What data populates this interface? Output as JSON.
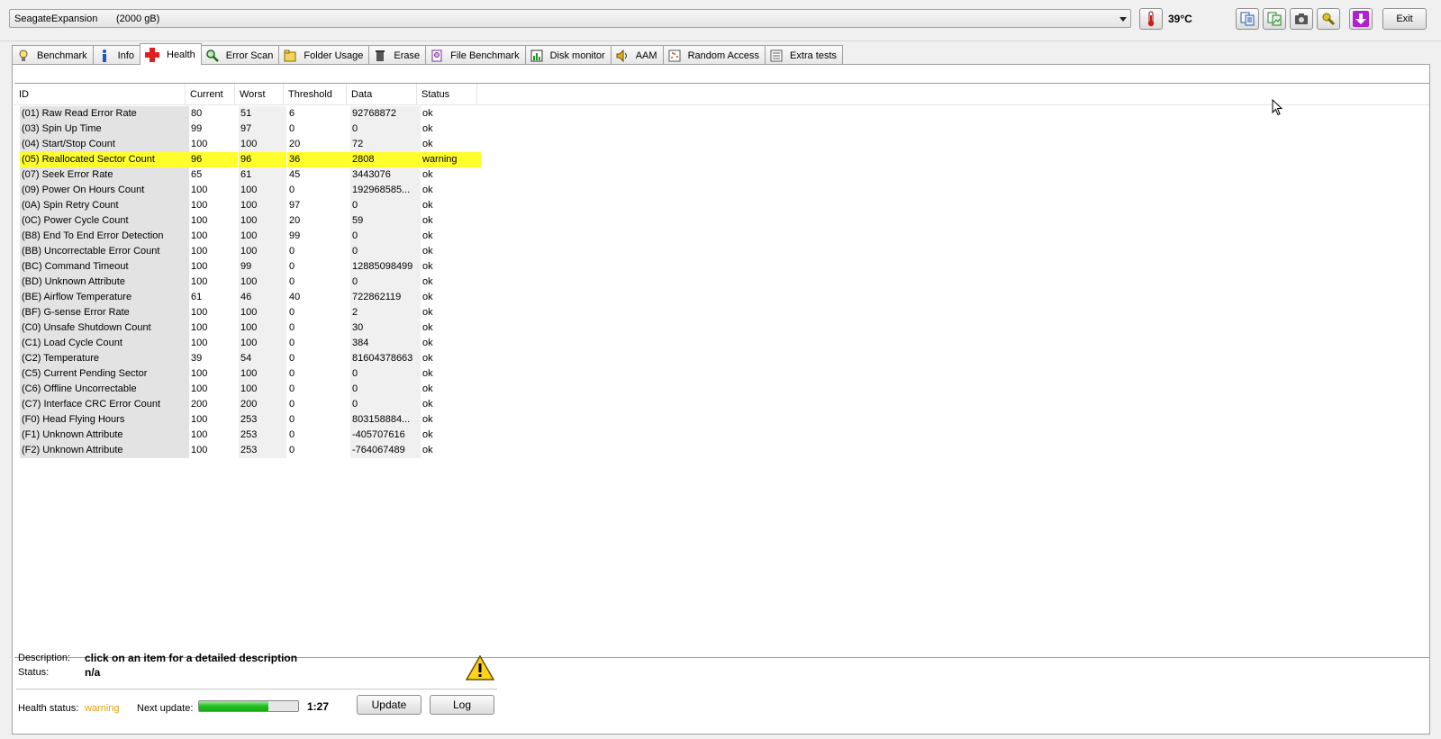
{
  "drive": {
    "name": "SeagateExpansion",
    "capacity": "(2000 gB)"
  },
  "temperature": "39°C",
  "toolbar": {
    "exit_label": "Exit"
  },
  "tabs": [
    {
      "label": "Benchmark",
      "icon": "bulb-icon"
    },
    {
      "label": "Info",
      "icon": "info-icon"
    },
    {
      "label": "Health",
      "icon": "health-cross-icon",
      "active": true
    },
    {
      "label": "Error Scan",
      "icon": "magnifier-icon"
    },
    {
      "label": "Folder Usage",
      "icon": "folder-icon"
    },
    {
      "label": "Erase",
      "icon": "trash-icon"
    },
    {
      "label": "File Benchmark",
      "icon": "file-benchmark-icon"
    },
    {
      "label": "Disk monitor",
      "icon": "monitor-chart-icon"
    },
    {
      "label": "AAM",
      "icon": "speaker-icon"
    },
    {
      "label": "Random Access",
      "icon": "random-access-icon"
    },
    {
      "label": "Extra tests",
      "icon": "extra-tests-icon"
    }
  ],
  "table": {
    "headers": {
      "id": "ID",
      "current": "Current",
      "worst": "Worst",
      "threshold": "Threshold",
      "data": "Data",
      "status": "Status"
    },
    "rows": [
      {
        "id": "(01) Raw Read Error Rate",
        "current": "80",
        "worst": "51",
        "threshold": "6",
        "data": "92768872",
        "status": "ok"
      },
      {
        "id": "(03) Spin Up Time",
        "current": "99",
        "worst": "97",
        "threshold": "0",
        "data": "0",
        "status": "ok"
      },
      {
        "id": "(04) Start/Stop Count",
        "current": "100",
        "worst": "100",
        "threshold": "20",
        "data": "72",
        "status": "ok"
      },
      {
        "id": "(05) Reallocated Sector Count",
        "current": "96",
        "worst": "96",
        "threshold": "36",
        "data": "2808",
        "status": "warning"
      },
      {
        "id": "(07) Seek Error Rate",
        "current": "65",
        "worst": "61",
        "threshold": "45",
        "data": "3443076",
        "status": "ok"
      },
      {
        "id": "(09) Power On Hours Count",
        "current": "100",
        "worst": "100",
        "threshold": "0",
        "data": "192968585...",
        "status": "ok"
      },
      {
        "id": "(0A) Spin Retry Count",
        "current": "100",
        "worst": "100",
        "threshold": "97",
        "data": "0",
        "status": "ok"
      },
      {
        "id": "(0C) Power Cycle Count",
        "current": "100",
        "worst": "100",
        "threshold": "20",
        "data": "59",
        "status": "ok"
      },
      {
        "id": "(B8) End To End Error Detection",
        "current": "100",
        "worst": "100",
        "threshold": "99",
        "data": "0",
        "status": "ok"
      },
      {
        "id": "(BB) Uncorrectable Error Count",
        "current": "100",
        "worst": "100",
        "threshold": "0",
        "data": "0",
        "status": "ok"
      },
      {
        "id": "(BC) Command Timeout",
        "current": "100",
        "worst": "99",
        "threshold": "0",
        "data": "12885098499",
        "status": "ok"
      },
      {
        "id": "(BD) Unknown Attribute",
        "current": "100",
        "worst": "100",
        "threshold": "0",
        "data": "0",
        "status": "ok"
      },
      {
        "id": "(BE) Airflow Temperature",
        "current": "61",
        "worst": "46",
        "threshold": "40",
        "data": "722862119",
        "status": "ok"
      },
      {
        "id": "(BF) G-sense Error Rate",
        "current": "100",
        "worst": "100",
        "threshold": "0",
        "data": "2",
        "status": "ok"
      },
      {
        "id": "(C0) Unsafe Shutdown Count",
        "current": "100",
        "worst": "100",
        "threshold": "0",
        "data": "30",
        "status": "ok"
      },
      {
        "id": "(C1) Load Cycle Count",
        "current": "100",
        "worst": "100",
        "threshold": "0",
        "data": "384",
        "status": "ok"
      },
      {
        "id": "(C2) Temperature",
        "current": "39",
        "worst": "54",
        "threshold": "0",
        "data": "81604378663",
        "status": "ok"
      },
      {
        "id": "(C5) Current Pending Sector",
        "current": "100",
        "worst": "100",
        "threshold": "0",
        "data": "0",
        "status": "ok"
      },
      {
        "id": "(C6) Offline Uncorrectable",
        "current": "100",
        "worst": "100",
        "threshold": "0",
        "data": "0",
        "status": "ok"
      },
      {
        "id": "(C7) Interface CRC Error Count",
        "current": "200",
        "worst": "200",
        "threshold": "0",
        "data": "0",
        "status": "ok"
      },
      {
        "id": "(F0) Head Flying Hours",
        "current": "100",
        "worst": "253",
        "threshold": "0",
        "data": "803158884...",
        "status": "ok"
      },
      {
        "id": "(F1) Unknown Attribute",
        "current": "100",
        "worst": "253",
        "threshold": "0",
        "data": "-405707616",
        "status": "ok"
      },
      {
        "id": "(F2) Unknown Attribute",
        "current": "100",
        "worst": "253",
        "threshold": "0",
        "data": "-764067489",
        "status": "ok"
      }
    ]
  },
  "details": {
    "description_label": "Description:",
    "description_value": "click on an item for a detailed description",
    "status_label": "Status:",
    "status_value": "n/a"
  },
  "footer": {
    "health_label": "Health status:",
    "health_value": "warning",
    "next_update_label": "Next update:",
    "progress_fraction": 0.7,
    "countdown": "1:27",
    "update_label": "Update",
    "log_label": "Log"
  },
  "colors": {
    "warning_row": "#ffff2e",
    "health_warning_text": "#e8a100",
    "progress_fill": "#1fbf1f"
  }
}
